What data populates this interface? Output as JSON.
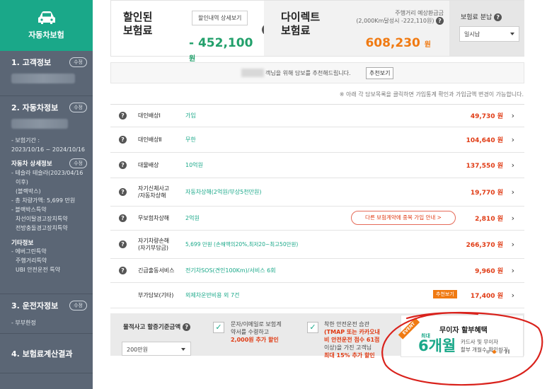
{
  "sidebar": {
    "brand": "자동차보험",
    "sections": [
      {
        "title": "1. 고객정보",
        "edit": "수정"
      },
      {
        "title": "2. 자동차정보",
        "edit": "수정"
      },
      {
        "title": "3. 운전자정보",
        "edit": "수정"
      },
      {
        "title": "4. 보험료계산결과"
      }
    ],
    "vehicle": {
      "period_label": "- 보험기간 :",
      "period": "2023/10/16 ~ 2024/10/16",
      "detail_title": "자동차 상세정보",
      "detail_edit": "수정",
      "detail_lines": [
        "- 테슬라 테슬라(2023/04/16",
        "이후)",
        "(블랙박스)",
        "- 총 차량가액: 5,699 만원",
        "- 블랙박스특약",
        "차선이탈경고장치특약",
        "전방충돌경고장치특약"
      ],
      "other_title": "기타정보",
      "other_lines": [
        "- 에버그린특약",
        "주행거리특약",
        "UBI 안전운전 특약"
      ]
    },
    "driver": {
      "line": "- 부부한정"
    }
  },
  "summary": {
    "discount_title_1": "할인된",
    "discount_title_2": "보험료",
    "detail_button": "할인내역 상세보기",
    "discount_value": "- 452,100",
    "won": "원",
    "direct_title_1": "다이렉트",
    "direct_title_2": "보험료",
    "mileage_1": "주행거리 예상환급금",
    "mileage_2": "(2,000Km달성시 -222,110원)",
    "direct_value": "608,230",
    "installment_label": "보험료 분납",
    "installment_value": "일시납"
  },
  "recommend": {
    "text": "객님을 위해 담보를 추천해드립니다.",
    "button": "추천보기",
    "notice": "※ 아래 각 담보목록을 클릭하면 가입통계 확인과 가입금액 변경이 가능합니다."
  },
  "coverages": [
    {
      "name": "대인배상Ⅰ",
      "value": "가입",
      "price": "49,730 원"
    },
    {
      "name": "대인배상Ⅱ",
      "value": "무한",
      "price": "104,640 원"
    },
    {
      "name": "대물배상",
      "value": "10억원",
      "price": "137,550 원"
    },
    {
      "name": "자기신체사고",
      "name2": "/자동차상해",
      "value": "자동차상해(2억원/부상5천만원)",
      "price": "19,770 원"
    },
    {
      "name": "무보험차상해",
      "value": "2억원",
      "button": "다른 보험계약에 중복 가입 안내 >",
      "price": "2,810 원"
    },
    {
      "name": "자기차량손해",
      "name2": "(자기부담금)",
      "value": "5,699 만원 (손해액의20%,최저20~최고50만원)",
      "price": "266,370 원"
    },
    {
      "name": "긴급출동서비스",
      "value": "전기차SOS(견인100Km)/서비스 6회",
      "price": "9,960 원"
    },
    {
      "name": "부가담보(기타)",
      "value": "외제차운반비용 외 7건",
      "tag": "추천보기",
      "price": "17,400 원"
    }
  ],
  "bottom": {
    "deductible_label": "물적사고 할증기준금액",
    "deductible_value": "200만원",
    "opt1_a": "문자/이메일로 보험계",
    "opt1_b": "약서를 수령하고",
    "opt1_c": "2,000원 추가 할인",
    "opt2_a": "착한 안전운전 습관",
    "opt2_b": "(TMAP 또는 카카오내",
    "opt2_c": "비 안전운전 점수 61점",
    "opt2_d": "이상)을 가진 고객님",
    "opt2_e": "최대 15% 추가 할인"
  },
  "promo": {
    "ribbon": "EVENT",
    "title": "무이자 할부혜택",
    "max": "최대",
    "big": "6개월",
    "sub1": "카드사 및 무이자",
    "sub2": "할부 개월수 확인하기"
  },
  "colors": {
    "brand": "#1aa889",
    "accent_orange": "#f07a12",
    "price_red": "#e03b14",
    "sidebar": "#5b6675",
    "annotation": "#d9221c"
  }
}
